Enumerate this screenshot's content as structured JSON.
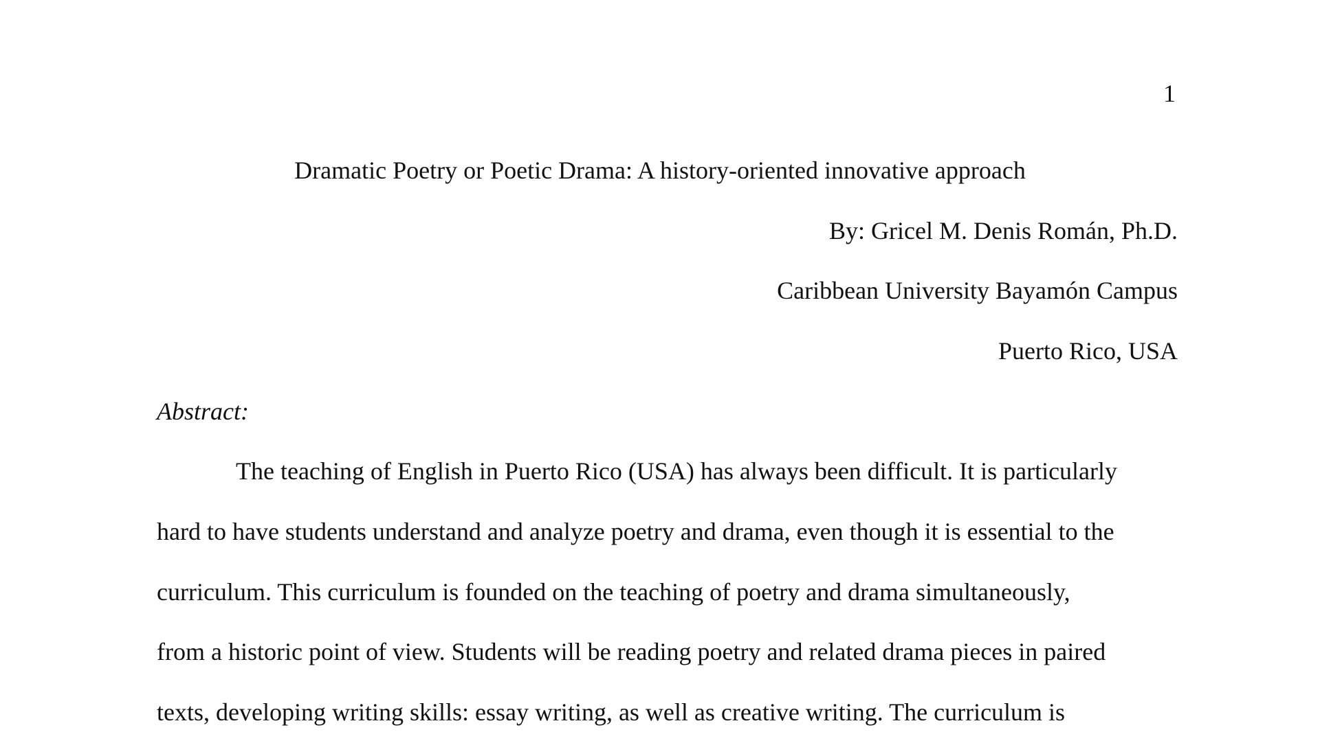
{
  "header": {
    "page_number": "1"
  },
  "title": "Dramatic Poetry or Poetic Drama: A history-oriented innovative approach",
  "byline": {
    "author": "By: Gricel M. Denis Román, Ph.D.",
    "institution": "Caribbean University Bayamón Campus",
    "location": "Puerto Rico, USA"
  },
  "abstract": {
    "heading": "Abstract:",
    "lines": [
      "The teaching of English in Puerto Rico (USA) has always been difficult. It is particularly",
      "hard to have students understand and analyze poetry and drama, even though it is essential to the",
      "curriculum.  This curriculum is founded on the teaching of poetry and drama simultaneously,",
      "from a historic point of view.  Students will be reading poetry and related drama pieces in paired",
      "texts, developing writing skills: essay writing, as well as creative writing.  The curriculum is"
    ]
  }
}
